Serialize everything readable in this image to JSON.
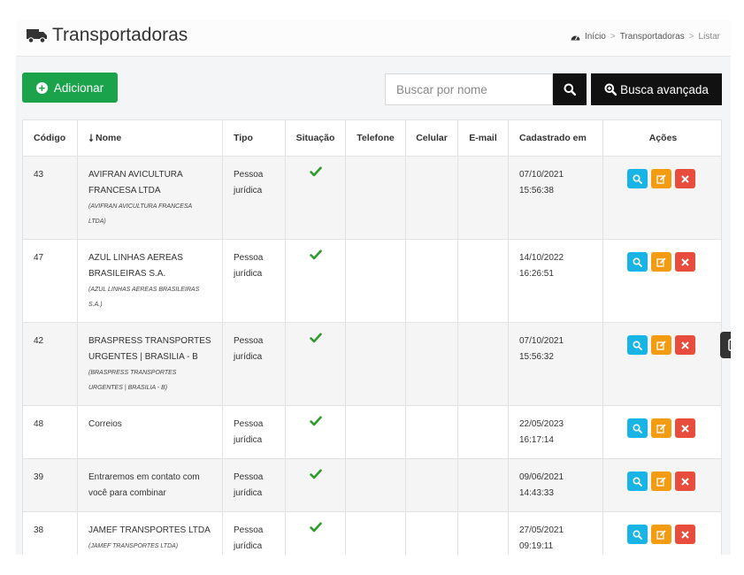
{
  "header": {
    "title": "Transportadoras",
    "breadcrumb": [
      "Início",
      "Transportadoras",
      "Listar"
    ]
  },
  "toolbar": {
    "add_label": "Adicionar",
    "search_placeholder": "Buscar por nome",
    "advanced_label": "Busca avançada"
  },
  "table": {
    "columns": [
      "Código",
      "Nome",
      "Tipo",
      "Situação",
      "Telefone",
      "Celular",
      "E-mail",
      "Cadastrado em",
      "Ações"
    ],
    "rows": [
      {
        "codigo": "43",
        "nome1": "AVIFRAN AVICULTURA",
        "nome2": "FRANCESA LTDA",
        "sub1": "(AVIFRAN AVICULTURA FRANCESA",
        "sub2": "LTDA)",
        "tipo1": "Pessoa",
        "tipo2": "jurídica",
        "data": "07/10/2021",
        "hora": "15:56:38"
      },
      {
        "codigo": "47",
        "nome1": "AZUL LINHAS AEREAS",
        "nome2": "BRASILEIRAS S.A.",
        "sub1": "(AZUL LINHAS AEREAS BRASILEIRAS",
        "sub2": "S.A.)",
        "tipo1": "Pessoa",
        "tipo2": "jurídica",
        "data": "14/10/2022",
        "hora": "16:26:51"
      },
      {
        "codigo": "42",
        "nome1": "BRASPRESS TRANSPORTES",
        "nome2": "URGENTES | BRASILIA - B",
        "sub1": "(BRASPRESS TRANSPORTES",
        "sub2": "URGENTES | BRASILIA - B)",
        "tipo1": "Pessoa",
        "tipo2": "jurídica",
        "data": "07/10/2021",
        "hora": "15:56:32"
      },
      {
        "codigo": "48",
        "nome1": "Correios",
        "nome2": "",
        "sub1": "",
        "sub2": "",
        "tipo1": "Pessoa",
        "tipo2": "jurídica",
        "data": "22/05/2023",
        "hora": "16:17:14"
      },
      {
        "codigo": "39",
        "nome1": "Entraremos em contato com",
        "nome2": "você para combinar",
        "sub1": "",
        "sub2": "",
        "tipo1": "Pessoa",
        "tipo2": "jurídica",
        "data": "09/06/2021",
        "hora": "14:43:33"
      },
      {
        "codigo": "38",
        "nome1": "JAMEF TRANSPORTES LTDA",
        "nome2": "",
        "sub1": "(JAMEF TRANSPORTES LTDA)",
        "sub2": "",
        "tipo1": "Pessoa",
        "tipo2": "jurídica",
        "data": "27/05/2021",
        "hora": "09:19:11"
      }
    ]
  },
  "colors": {
    "add_button": "#1aa34a",
    "dark_button": "#111111",
    "check": "#2e9a2e",
    "view": "#19b4e6",
    "edit": "#f39c12",
    "delete": "#e74c3c"
  },
  "icons": {
    "title": "truck-icon",
    "breadcrumb": "dashboard-icon",
    "add": "plus-circle-icon",
    "search": "search-icon",
    "advanced": "search-plus-icon",
    "sort": "sort-icon",
    "status": "check-icon",
    "view": "search-icon",
    "edit": "edit-icon",
    "delete": "close-icon",
    "side_tab": "play-icon"
  }
}
